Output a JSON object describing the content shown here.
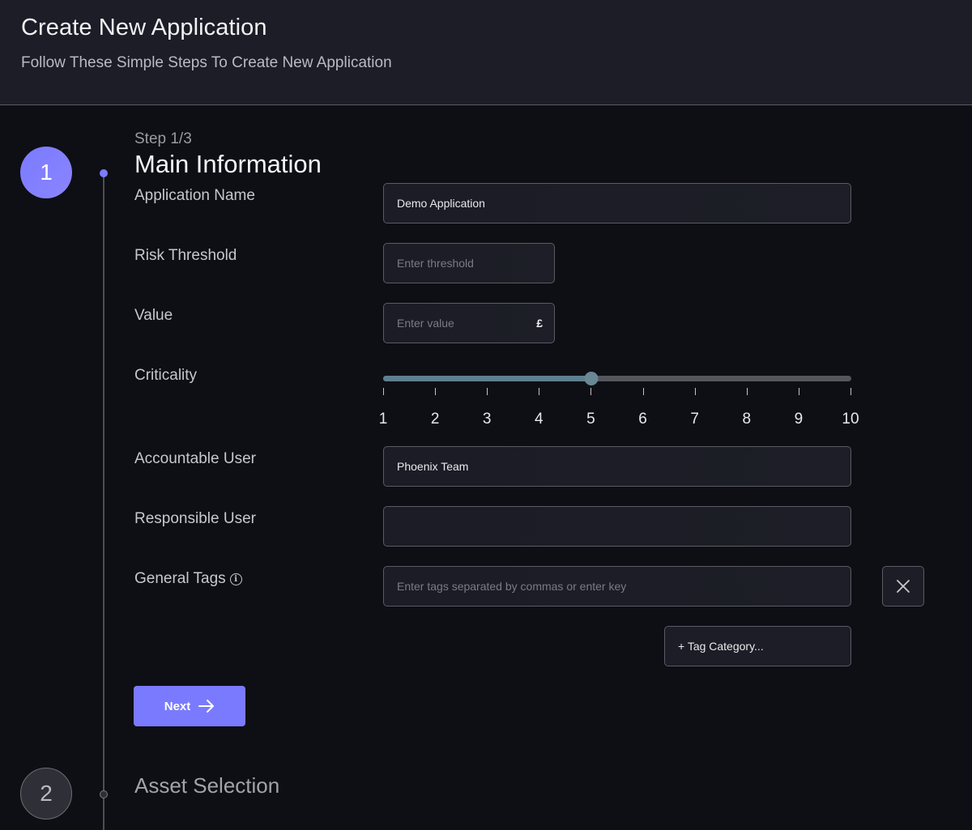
{
  "header": {
    "title": "Create New Application",
    "subtitle": "Follow These Simple Steps To Create New Application"
  },
  "stepper": {
    "steps": [
      {
        "number": "1",
        "title": "Main Information",
        "state": "active"
      },
      {
        "number": "2",
        "title": "Asset Selection",
        "state": "inactive"
      }
    ],
    "counter": "Step 1/3"
  },
  "form": {
    "application_name": {
      "label": "Application Name",
      "value": "Demo Application",
      "placeholder": ""
    },
    "risk_threshold": {
      "label": "Risk Threshold",
      "value": "",
      "placeholder": "Enter threshold"
    },
    "value": {
      "label": "Value",
      "value": "",
      "placeholder": "Enter value",
      "currency_symbol": "£"
    },
    "criticality": {
      "label": "Criticality",
      "min": 1,
      "max": 10,
      "value": 5,
      "ticks": [
        "1",
        "2",
        "3",
        "4",
        "5",
        "6",
        "7",
        "8",
        "9",
        "10"
      ]
    },
    "accountable_user": {
      "label": "Accountable User",
      "value": "Phoenix Team"
    },
    "responsible_user": {
      "label": "Responsible User",
      "value": ""
    },
    "general_tags": {
      "label": "General Tags",
      "placeholder": "Enter tags separated by commas or enter key",
      "info_icon": "info-icon",
      "clear_icon": "close-icon"
    },
    "tag_category_button": "+ Tag Category...",
    "next_button": "Next"
  },
  "colors": {
    "accent": "#7a7afe",
    "slider_fill": "#5f7f8e",
    "header_bg": "#1c1d26",
    "page_bg": "#0e0f14"
  }
}
